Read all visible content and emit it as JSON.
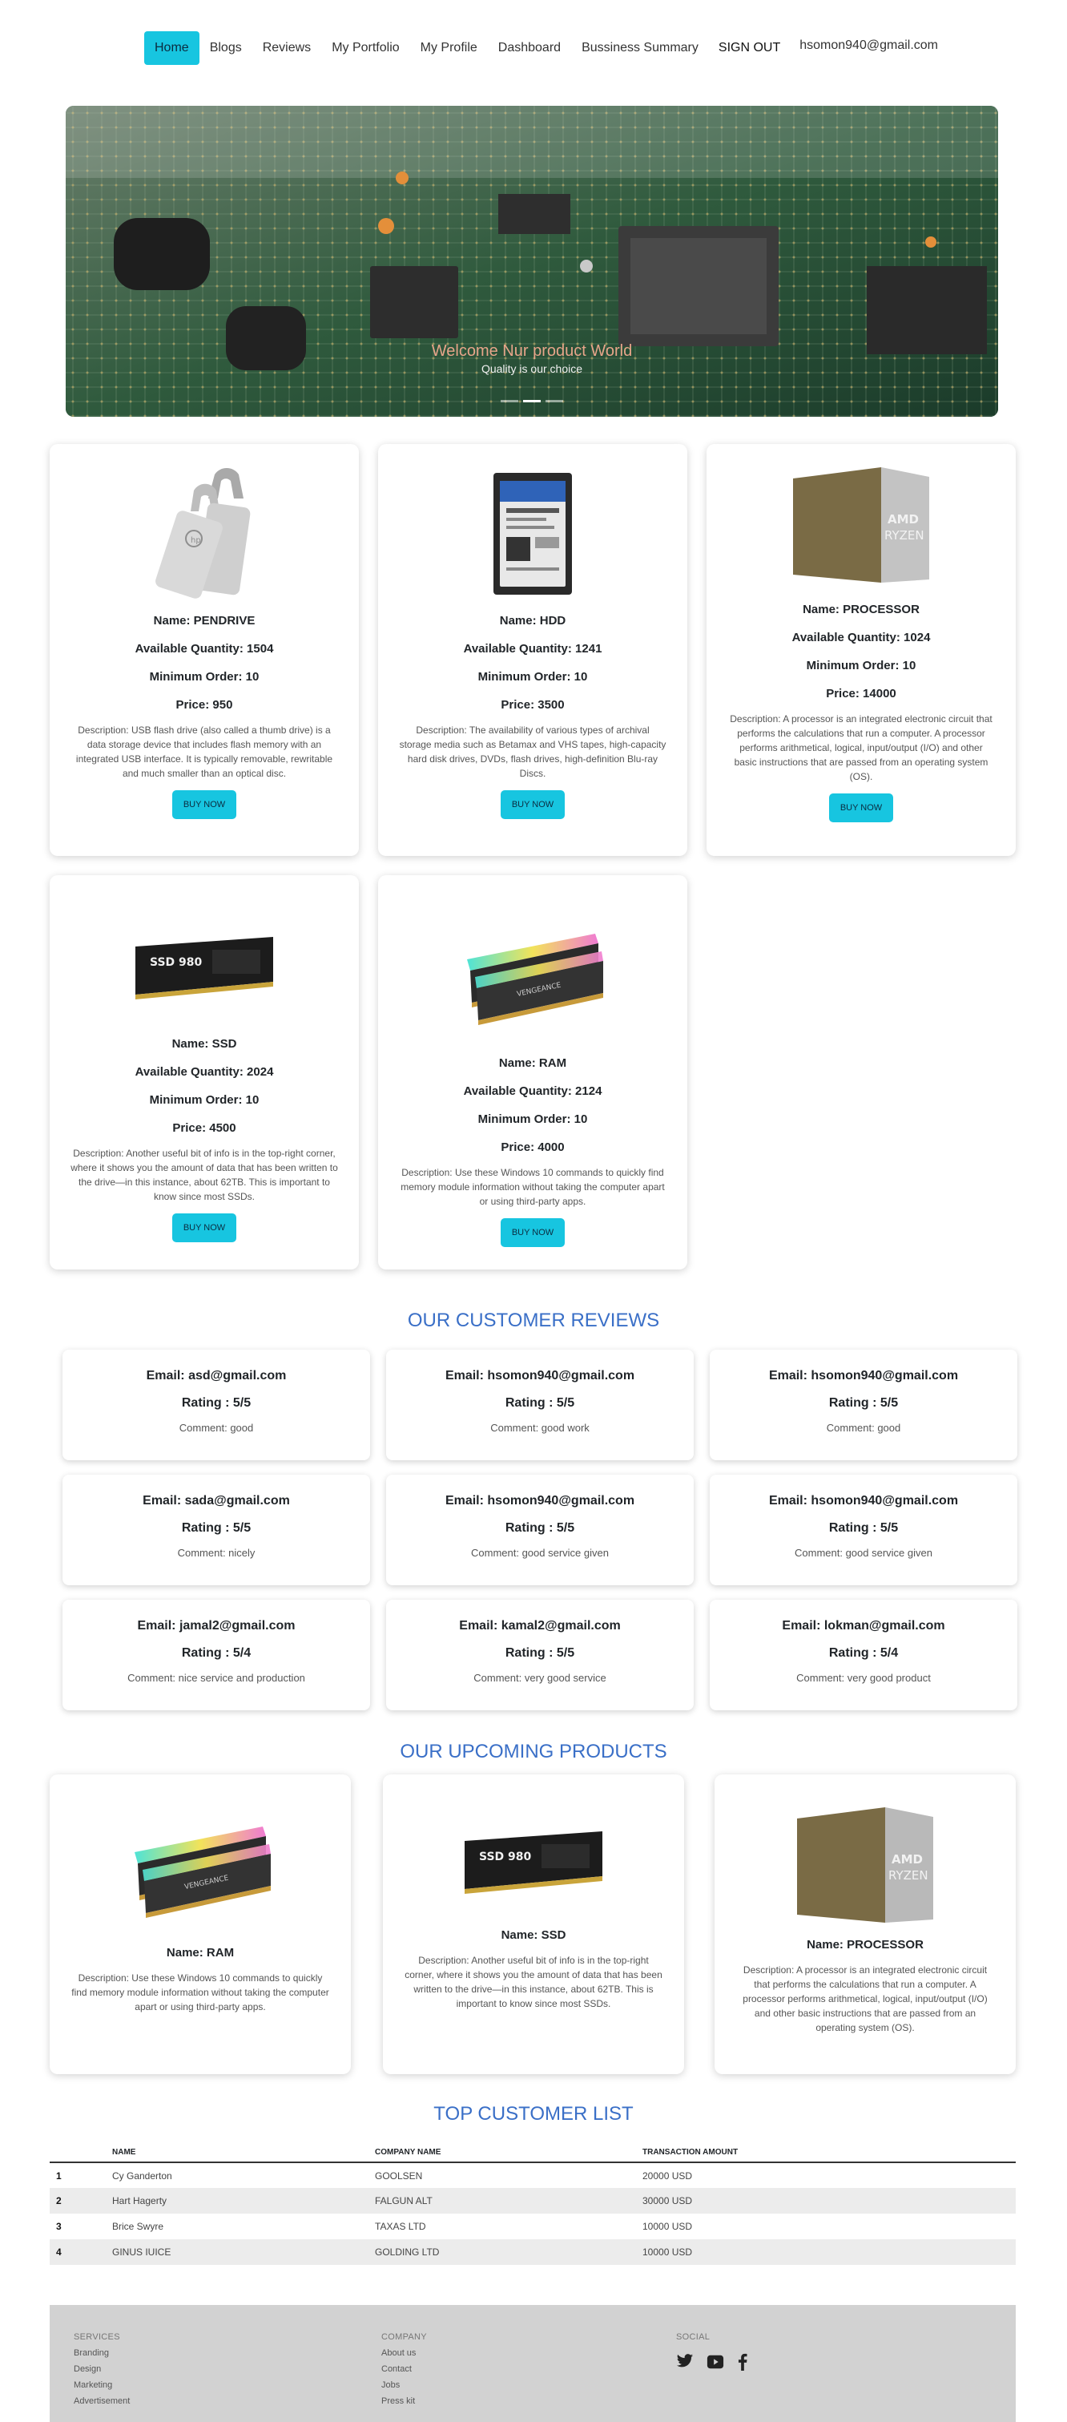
{
  "nav": {
    "items": [
      "Home",
      "Blogs",
      "Reviews",
      "My Portfolio",
      "My Profile",
      "Dashboard",
      "Bussiness Summary"
    ],
    "signout": "SIGN OUT",
    "email": "hsomon940@gmail.com"
  },
  "hero": {
    "title": "Welcome Nur product World",
    "subtitle": "Quality is our choice"
  },
  "products": [
    {
      "name": "Name: PENDRIVE",
      "qty": "Available Quantity: 1504",
      "min": "Minimum Order: 10",
      "price": "Price: 950",
      "desc": "Description: USB flash drive (also called a thumb drive) is a data storage device that includes flash memory with an integrated USB interface. It is typically removable, rewritable and much smaller than an optical disc.",
      "button": "BUY NOW",
      "icon": "pendrive-image"
    },
    {
      "name": "Name: HDD",
      "qty": "Available Quantity: 1241",
      "min": "Minimum Order: 10",
      "price": "Price: 3500",
      "desc": "Description: The availability of various types of archival storage media such as Betamax and VHS tapes, high-capacity hard disk drives, DVDs, flash drives, high-definition Blu-ray Discs.",
      "button": "BUY NOW",
      "icon": "hdd-image"
    },
    {
      "name": "Name: PROCESSOR",
      "qty": "Available Quantity: 1024",
      "min": "Minimum Order: 10",
      "price": "Price: 14000",
      "desc": "Description: A processor is an integrated electronic circuit that performs the calculations that run a computer. A processor performs arithmetical, logical, input/output (I/O) and other basic instructions that are passed from an operating system (OS).",
      "button": "BUY NOW",
      "icon": "processor-image"
    },
    {
      "name": "Name: SSD",
      "qty": "Available Quantity: 2024",
      "min": "Minimum Order: 10",
      "price": "Price: 4500",
      "desc": "Description: Another useful bit of info is in the top-right corner, where it shows you the amount of data that has been written to the drive—in this instance, about 62TB. This is important to know since most SSDs.",
      "button": "BUY NOW",
      "icon": "ssd-image"
    },
    {
      "name": "Name: RAM",
      "qty": "Available Quantity: 2124",
      "min": "Minimum Order: 10",
      "price": "Price: 4000",
      "desc": "Description: Use these Windows 10 commands to quickly find memory module information without taking the computer apart or using third-party apps.",
      "button": "BUY NOW",
      "icon": "ram-image"
    }
  ],
  "reviews_title": "OUR CUSTOMER REVIEWS",
  "reviews": [
    {
      "email": "Email: asd@gmail.com",
      "rating": "Rating : 5/5",
      "comment": "Comment: good"
    },
    {
      "email": "Email: hsomon940@gmail.com",
      "rating": "Rating : 5/5",
      "comment": "Comment: good work"
    },
    {
      "email": "Email: hsomon940@gmail.com",
      "rating": "Rating : 5/5",
      "comment": "Comment: good"
    },
    {
      "email": "Email: sada@gmail.com",
      "rating": "Rating : 5/5",
      "comment": "Comment: nicely"
    },
    {
      "email": "Email: hsomon940@gmail.com",
      "rating": "Rating : 5/5",
      "comment": "Comment: good service given"
    },
    {
      "email": "Email: hsomon940@gmail.com",
      "rating": "Rating : 5/5",
      "comment": "Comment: good service given"
    },
    {
      "email": "Email: jamal2@gmail.com",
      "rating": "Rating : 5/4",
      "comment": "Comment: nice service and production"
    },
    {
      "email": "Email: kamal2@gmail.com",
      "rating": "Rating : 5/5",
      "comment": "Comment: very good service"
    },
    {
      "email": "Email: lokman@gmail.com",
      "rating": "Rating : 5/4",
      "comment": "Comment: very good product"
    }
  ],
  "upcoming_title": "OUR UPCOMING PRODUCTS",
  "upcoming": [
    {
      "name": "Name: RAM",
      "desc": "Description: Use these Windows 10 commands to quickly find memory module information without taking the computer apart or using third-party apps."
    },
    {
      "name": "Name: SSD",
      "desc": "Description: Another useful bit of info is in the top-right corner, where it shows you the amount of data that has been written to the drive—in this instance, about 62TB. This is important to know since most SSDs."
    },
    {
      "name": "Name: PROCESSOR",
      "desc": "Description: A processor is an integrated electronic circuit that performs the calculations that run a computer. A processor performs arithmetical, logical, input/output (I/O) and other basic instructions that are passed from an operating system (OS)."
    }
  ],
  "customers_title": "TOP CUSTOMER LIST",
  "table": {
    "headers": [
      "NAME",
      "COMPANY NAME",
      "TRANSACTION AMOUNT"
    ],
    "rows": [
      [
        "1",
        "Cy Ganderton",
        "GOOLSEN",
        "20000 USD"
      ],
      [
        "2",
        "Hart Hagerty",
        "FALGUN ALT",
        "30000 USD"
      ],
      [
        "3",
        "Brice Swyre",
        "TAXAS LTD",
        "10000 USD"
      ],
      [
        "4",
        "GINUS IUICE",
        "GOLDING LTD",
        "10000 USD"
      ]
    ]
  },
  "footer": {
    "services_head": "SERVICES",
    "services": [
      "Branding",
      "Design",
      "Marketing",
      "Advertisement"
    ],
    "company_head": "COMPANY",
    "company": [
      "About us",
      "Contact",
      "Jobs",
      "Press kit"
    ],
    "social_head": "SOCIAL",
    "social_icons": [
      "twitter-icon",
      "youtube-icon",
      "facebook-icon"
    ]
  },
  "colors": {
    "accent": "#17c5e0",
    "section_title": "#3a6fc7"
  }
}
